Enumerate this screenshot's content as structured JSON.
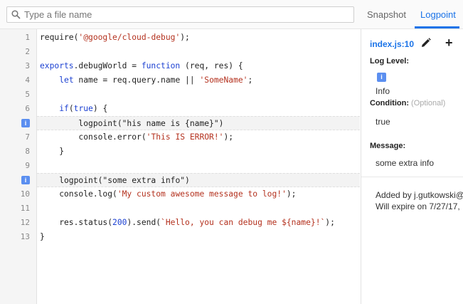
{
  "search": {
    "placeholder": "Type a file name"
  },
  "tabs": {
    "snapshot": "Snapshot",
    "logpoint": "Logpoint"
  },
  "code_lines": [
    {
      "n": "1",
      "text": "require('@google/cloud-debug');"
    },
    {
      "n": "2",
      "text": ""
    },
    {
      "n": "3",
      "text": "exports.debugWorld = function (req, res) {"
    },
    {
      "n": "4",
      "text": "    let name = req.query.name || 'SomeName';"
    },
    {
      "n": "5",
      "text": ""
    },
    {
      "n": "6",
      "text": "    if(true) {"
    },
    {
      "n": "",
      "marker": "i",
      "text": "        logpoint(\"his name is {name}\")"
    },
    {
      "n": "7",
      "text": "        console.error('This IS ERROR!');"
    },
    {
      "n": "8",
      "text": "    }"
    },
    {
      "n": "9",
      "text": ""
    },
    {
      "n": "",
      "marker": "i",
      "text": "    logpoint(\"some extra info\")"
    },
    {
      "n": "10",
      "text": "    console.log('My custom awesome message to log!');"
    },
    {
      "n": "11",
      "text": ""
    },
    {
      "n": "12",
      "text": "    res.status(200).send(`Hello, you can debug me ${name}!`);"
    },
    {
      "n": "13",
      "text": "}"
    }
  ],
  "panel": {
    "file": "index.js:10",
    "log_level_label": "Log Level:",
    "log_level_badge": "i",
    "log_level_value": "Info",
    "condition_label": "Condition:",
    "condition_optional": "(Optional)",
    "condition_value": "true",
    "message_label": "Message:",
    "message_value": "some extra info",
    "added_by": "Added by j.gutkowski@",
    "expires": "Will expire on 7/27/17,"
  },
  "colors": {
    "accent": "#1a73e8",
    "logpoint_marker": "#5b8ff0",
    "string": "#b4321f",
    "keyword": "#1a3fd1"
  }
}
